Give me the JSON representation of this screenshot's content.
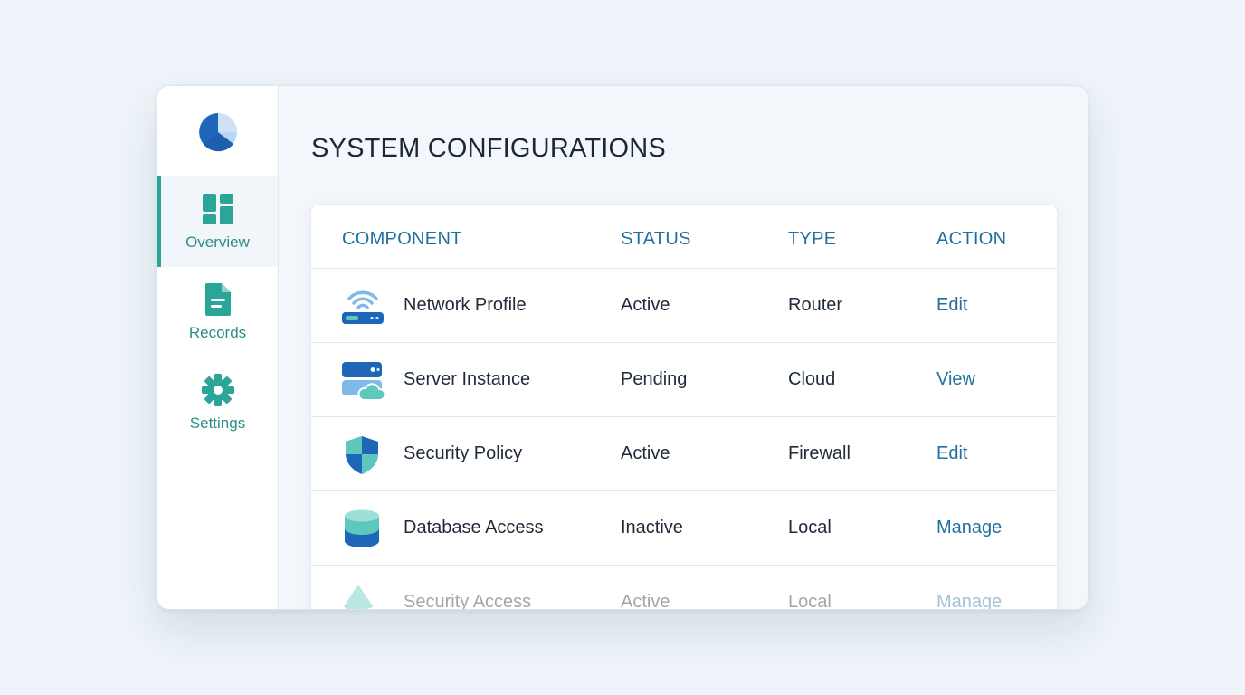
{
  "sidebar": {
    "logo_icon": "pie-logo-icon",
    "items": [
      {
        "label": "Overview",
        "icon": "dashboard-icon",
        "active": true
      },
      {
        "label": "Records",
        "icon": "document-icon",
        "active": false
      },
      {
        "label": "Settings",
        "icon": "gear-icon",
        "active": false
      }
    ]
  },
  "main": {
    "title": "SYSTEM CONFIGURATIONS",
    "table": {
      "headers": [
        "COMPONENT",
        "STATUS",
        "TYPE",
        "ACTION"
      ],
      "rows": [
        {
          "icon": "wifi-router-icon",
          "component": "Network Profile",
          "status": "Active",
          "type": "Router",
          "action": "Edit"
        },
        {
          "icon": "server-cloud-icon",
          "component": "Server Instance",
          "status": "Pending",
          "type": "Cloud",
          "action": "View"
        },
        {
          "icon": "shield-icon",
          "component": "Security Policy",
          "status": "Active",
          "type": "Firewall",
          "action": "Edit"
        },
        {
          "icon": "database-icon",
          "component": "Database Access",
          "status": "Inactive",
          "type": "Local",
          "action": "Manage"
        },
        {
          "icon": "security-access-icon",
          "component": "Security Access",
          "status": "Active",
          "type": "Local",
          "action": "Manage"
        }
      ]
    }
  },
  "colors": {
    "accent": "#2aa598",
    "header_text": "#1f6f9f",
    "link": "#21709f",
    "page_bg": "#eef4f9"
  }
}
